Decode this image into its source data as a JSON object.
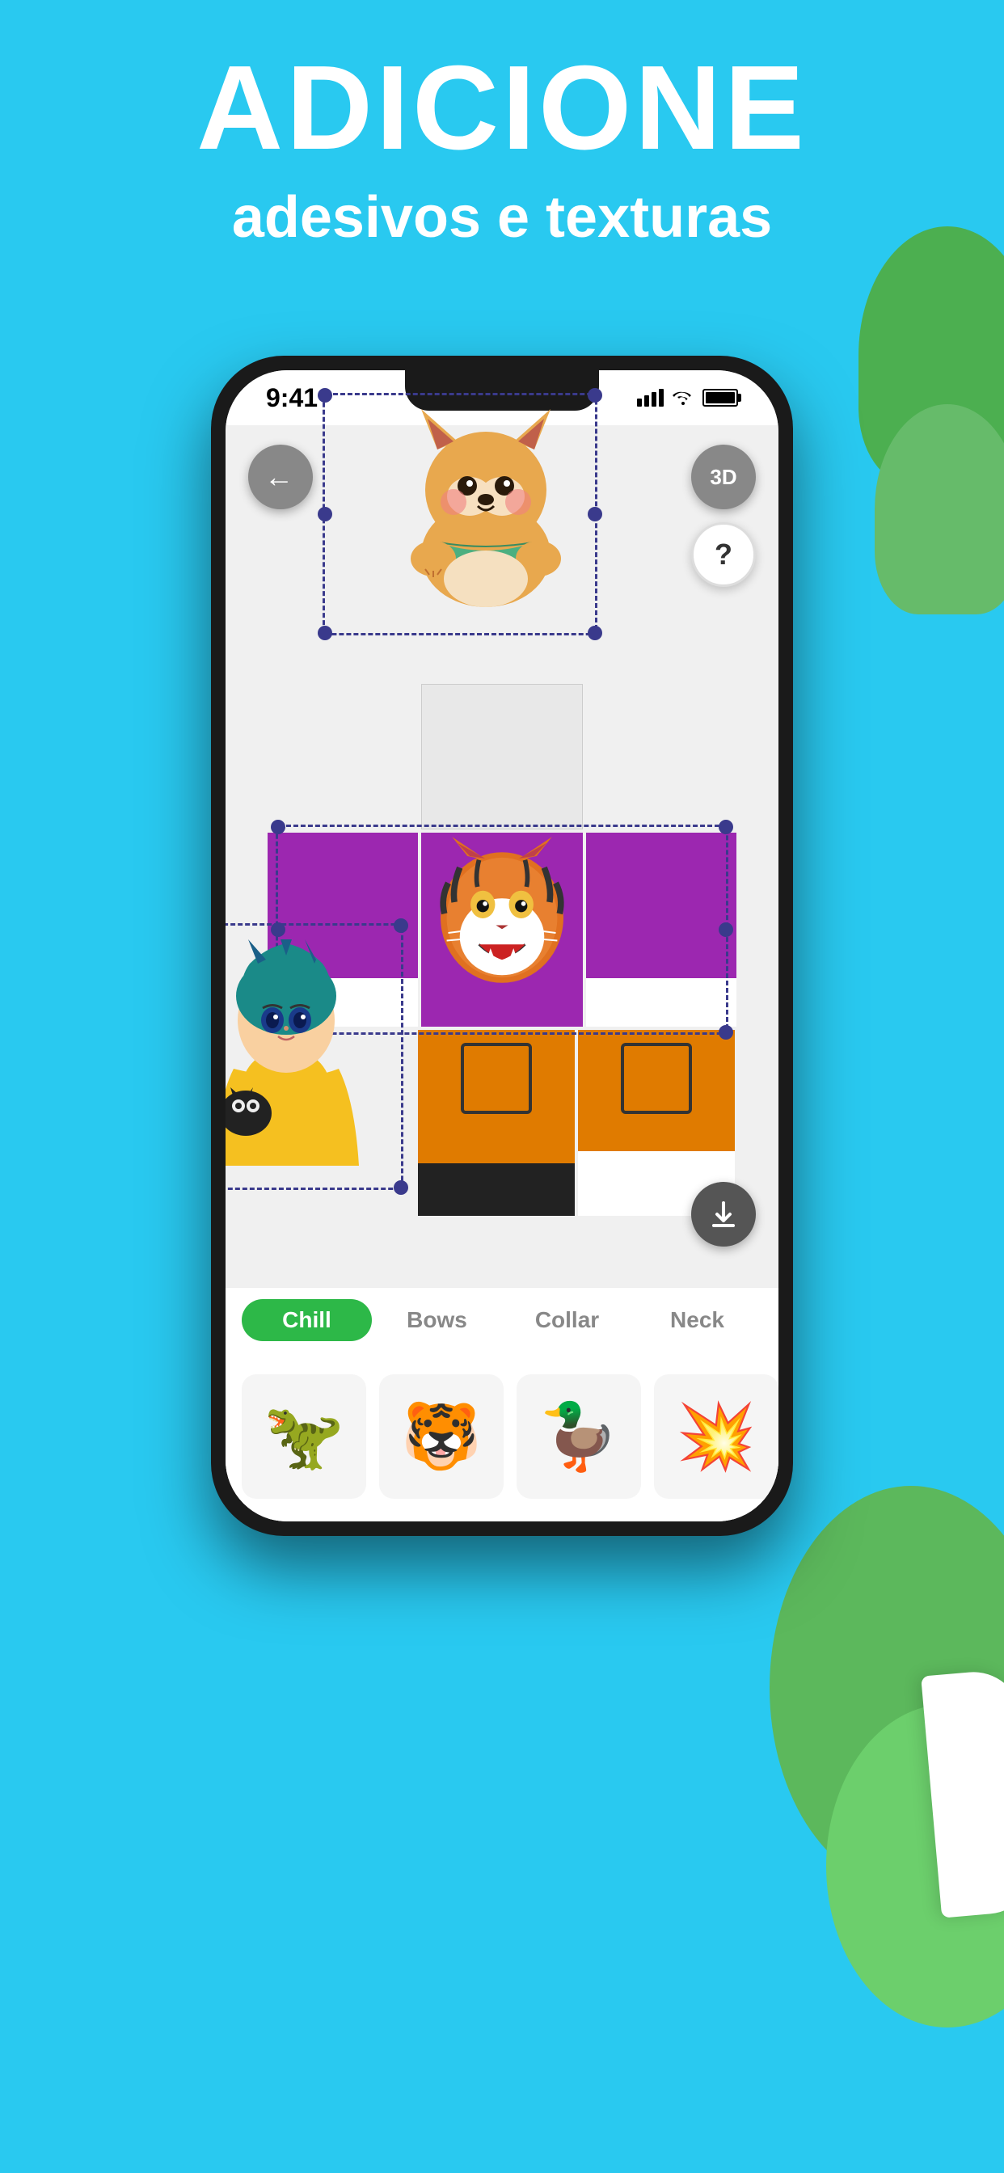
{
  "background_color": "#29c9f0",
  "header": {
    "main_title": "ADICIONE",
    "sub_title": "adesivos e texturas"
  },
  "status_bar": {
    "time": "9:41",
    "signal": "signal",
    "wifi": "wifi",
    "battery": "battery"
  },
  "app": {
    "back_button_label": "←",
    "btn_3d_label": "3D",
    "btn_help_label": "?",
    "download_button_label": "↓"
  },
  "tabs": [
    {
      "label": "Chill",
      "active": true
    },
    {
      "label": "Bows",
      "active": false
    },
    {
      "label": "Collar",
      "active": false
    },
    {
      "label": "Neck",
      "active": false
    }
  ],
  "stickers": [
    {
      "emoji": "🦕",
      "label": "dinosaur"
    },
    {
      "emoji": "🐯",
      "label": "tiger-face"
    },
    {
      "emoji": "🦆",
      "label": "duck"
    },
    {
      "emoji": "💥",
      "label": "explosion"
    }
  ],
  "colors": {
    "sky_blue": "#29c9f0",
    "purple_shirt": "#9c27b0",
    "orange_pants": "#e07b00",
    "green_tab": "#2db848",
    "dark_handle": "#3a3a8c"
  }
}
